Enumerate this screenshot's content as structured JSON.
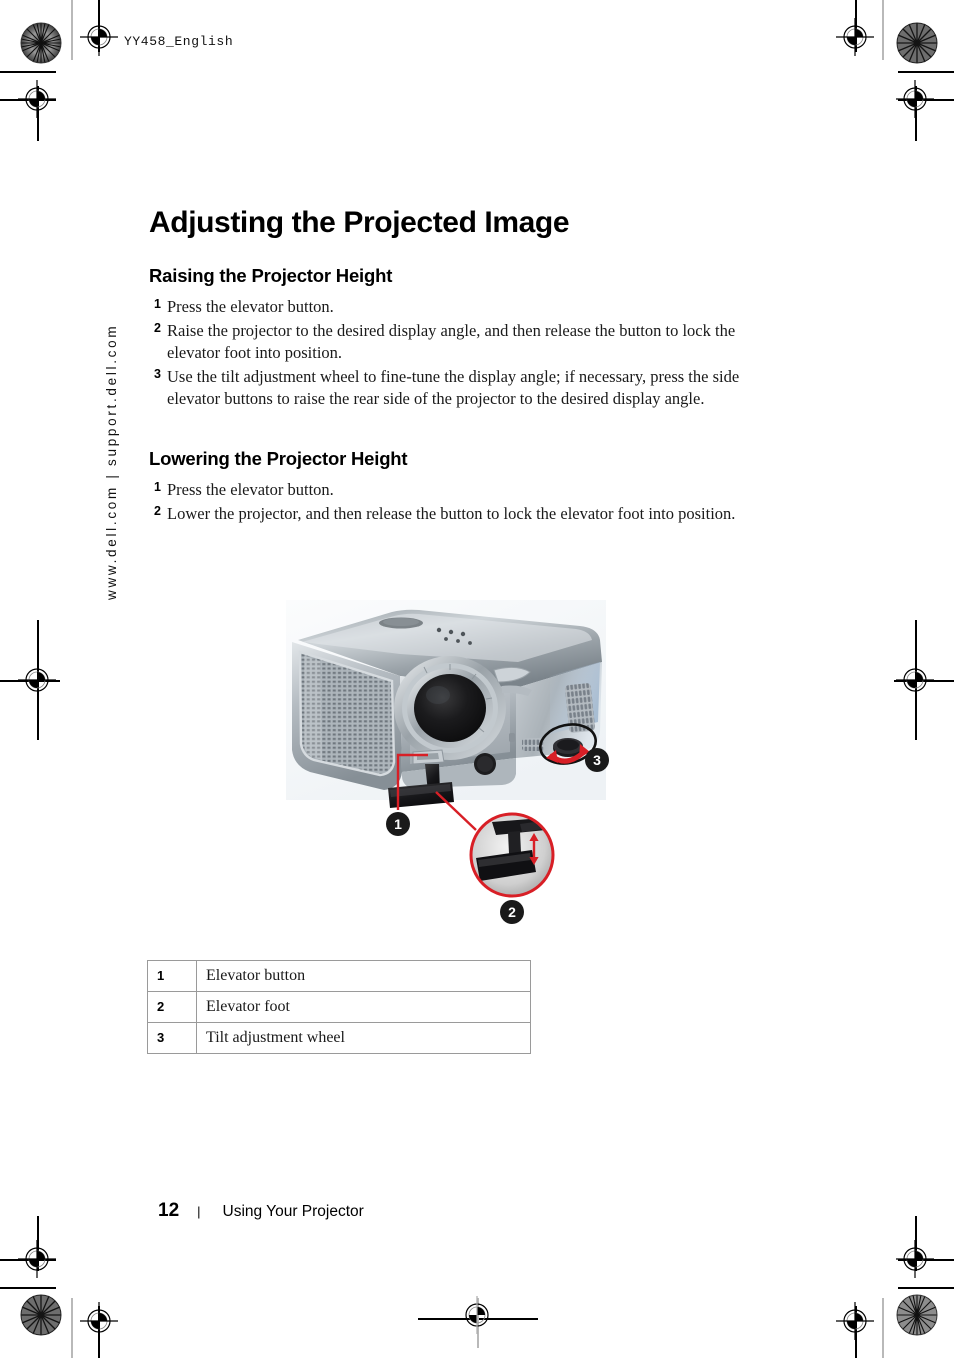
{
  "print_marks": {
    "doc_code": "YY458_English"
  },
  "sidebar": {
    "url_text": "www.dell.com | support.dell.com"
  },
  "main": {
    "title": "Adjusting the Projected Image",
    "sections": [
      {
        "heading": "Raising the Projector Height",
        "steps": [
          {
            "num": "1",
            "text": "Press the elevator button."
          },
          {
            "num": "2",
            "text": "Raise the projector to the desired display angle, and then release the button to lock the elevator foot into position."
          },
          {
            "num": "3",
            "text": "Use the tilt adjustment wheel to fine-tune the display angle; if necessary, press the side elevator buttons to raise the rear side of the projector to the desired display angle."
          }
        ]
      },
      {
        "heading": "Lowering the Projector Height",
        "steps": [
          {
            "num": "1",
            "text": "Press the elevator button."
          },
          {
            "num": "2",
            "text": "Lower the projector, and then release the button to lock the elevator foot into position."
          }
        ]
      }
    ]
  },
  "figure": {
    "alt": "Dell projector three-quarter view with elevator foot extended",
    "callouts": [
      {
        "id": "1",
        "label": "1"
      },
      {
        "id": "2",
        "label": "2"
      },
      {
        "id": "3",
        "label": "3"
      }
    ],
    "colors": {
      "leader_line": "#d81f26",
      "callout_bg": "#1a1a1a",
      "callout_text": "#ffffff",
      "body_light": "#d9dde0",
      "body_mid": "#a8b0b6",
      "body_dark": "#7d868d",
      "lens": "#141414",
      "foot": "#1c1c1c",
      "inset_ring": "#d81f26"
    }
  },
  "legend_table": {
    "rows": [
      {
        "idx": "1",
        "desc": "Elevator button"
      },
      {
        "idx": "2",
        "desc": "Elevator foot"
      },
      {
        "idx": "3",
        "desc": "Tilt adjustment wheel"
      }
    ]
  },
  "footer": {
    "page_number": "12",
    "separator": "|",
    "title": "Using Your Projector"
  }
}
